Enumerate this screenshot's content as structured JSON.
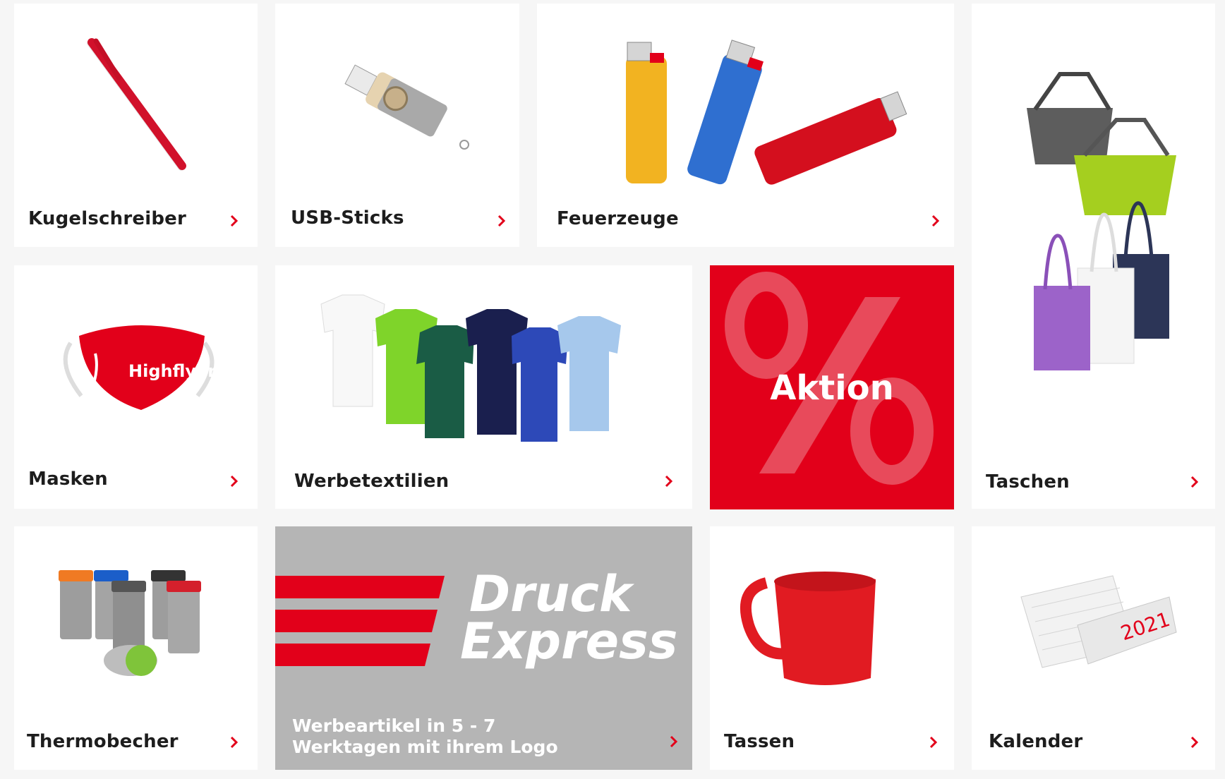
{
  "tiles": {
    "kugelschreiber": {
      "label": "Kugelschreiber"
    },
    "usb": {
      "label": "USB-Sticks"
    },
    "feuerzeuge": {
      "label": "Feuerzeuge"
    },
    "taschen": {
      "label": "Taschen"
    },
    "masken": {
      "label": "Masken",
      "mask_text": "Highflyers"
    },
    "werbetextilien": {
      "label": "Werbetextilien"
    },
    "aktion": {
      "label": "Aktion"
    },
    "thermobecher": {
      "label": "Thermobecher"
    },
    "express": {
      "brand_line1": "Druck",
      "brand_line2": "Express",
      "subtitle_line1": "Werbeartikel in 5 - 7",
      "subtitle_line2": "Werktagen mit ihrem Logo"
    },
    "tassen": {
      "label": "Tassen"
    },
    "kalender": {
      "label": "Kalender",
      "year": "2021"
    }
  },
  "colors": {
    "accent_red": "#e2001a",
    "tile_bg": "#ffffff",
    "page_bg": "#f6f6f6",
    "express_bg": "#b5b5b5"
  },
  "icons": {
    "chevron": "chevron-right-icon"
  }
}
